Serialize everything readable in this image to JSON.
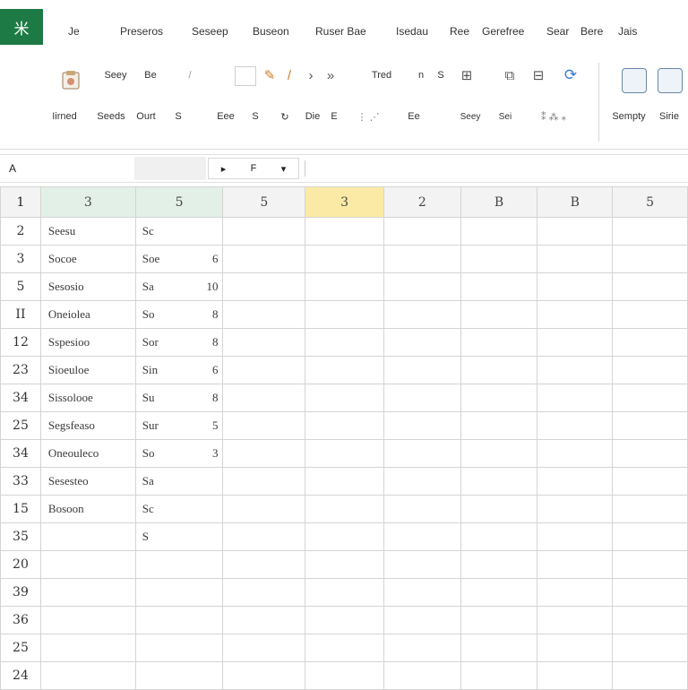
{
  "app": {
    "logo_text": "米",
    "accent": "#1e7a45"
  },
  "menu": [
    "Je",
    "Preseros",
    "Seseep",
    "Buseon",
    "Ruser Bae",
    "Isedau",
    "Ree",
    "Gerefree",
    "Sear",
    "Bere",
    "Jais"
  ],
  "ribbon": {
    "row1": [
      "Seey",
      "Be",
      "/",
      "/",
      "Tred",
      "n",
      "S",
      "B",
      "Bl"
    ],
    "row2": [
      "Iirned",
      "Seeds",
      "Ourt",
      "S",
      "Eee",
      "S",
      "Die",
      "Ee",
      "Seey",
      "Sei"
    ],
    "right_labels": [
      "Sempty",
      "Sirie"
    ],
    "accent_icon_color": "#d07a1f"
  },
  "formula_bar": {
    "name_box": "A",
    "dropdown_left": "▸",
    "dropdown_mid": "F",
    "dropdown_caret": "▾"
  },
  "columns": [
    "3",
    "5",
    "5",
    "3",
    "2",
    "B",
    "B",
    "5"
  ],
  "corner": "1",
  "active_column": "3",
  "rows": [
    {
      "num": "2",
      "a": "Seesu",
      "b": "Sc",
      "b_val": ""
    },
    {
      "num": "3",
      "a": "Socoe",
      "b": "Soe",
      "b_val": "6"
    },
    {
      "num": "5",
      "a": "Sesosio",
      "b": "Sa",
      "b_val": "10"
    },
    {
      "num": "II",
      "a": "Oneiolea",
      "b": "So",
      "b_val": "8"
    },
    {
      "num": "12",
      "a": "Sspesioo",
      "b": "Sor",
      "b_val": "8"
    },
    {
      "num": "23",
      "a": "Sioeuloe",
      "b": "Sin",
      "b_val": "6"
    },
    {
      "num": "34",
      "a": "Sissolooe",
      "b": "Su",
      "b_val": "8"
    },
    {
      "num": "25",
      "a": "Segsfeaso",
      "b": "Sur",
      "b_val": "5"
    },
    {
      "num": "34",
      "a": "Oneouleco",
      "b": "So",
      "b_val": "3"
    },
    {
      "num": "33",
      "a": "Sesesteo",
      "b": "Sa",
      "b_val": ""
    },
    {
      "num": "15",
      "a": "Bosoon",
      "b": "Sc",
      "b_val": ""
    },
    {
      "num": "35",
      "a": "",
      "b": "S",
      "b_val": ""
    },
    {
      "num": "20",
      "a": "",
      "b": "",
      "b_val": ""
    },
    {
      "num": "39",
      "a": "",
      "b": "",
      "b_val": ""
    },
    {
      "num": "36",
      "a": "",
      "b": "",
      "b_val": ""
    },
    {
      "num": "25",
      "a": "",
      "b": "",
      "b_val": ""
    },
    {
      "num": "24",
      "a": "",
      "b": "",
      "b_val": ""
    }
  ]
}
